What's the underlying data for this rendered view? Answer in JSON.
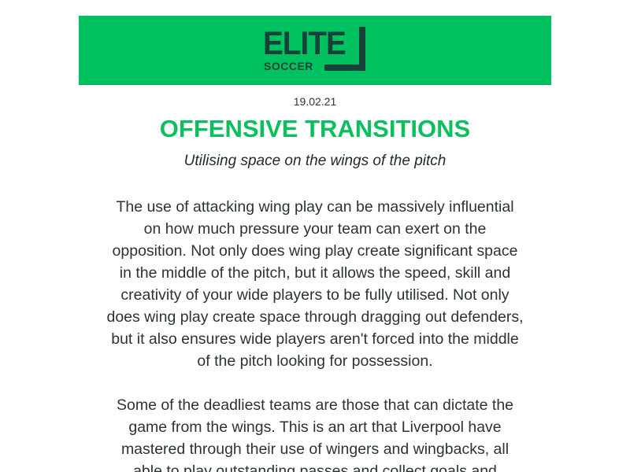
{
  "header": {
    "logo_main": "ELITE",
    "logo_sub": "SOCCER",
    "background_color": "#00c160"
  },
  "article": {
    "date": "19.02.21",
    "title": "OFFENSIVE TRANSITIONS",
    "subtitle": "Utilising space on the wings of the pitch",
    "paragraphs": [
      "The use of attacking wing play can be massively influential on how much pressure your team can exert on the opposition. Not only does wing play create significant space in the middle of the pitch, but it allows the speed, skill and creativity of your wide players to be fully utilised. Not only does wing play create space through dragging out defenders, but it also ensures wide players aren't forced into the middle of the pitch looking for possession.",
      "Some of the deadliest teams are those that can dictate the game from the wings. This is an art that Liverpool have mastered through their use of wingers and wingbacks, all able to play outstanding passes and collect goals and"
    ],
    "title_color": "#0cbf5e"
  }
}
